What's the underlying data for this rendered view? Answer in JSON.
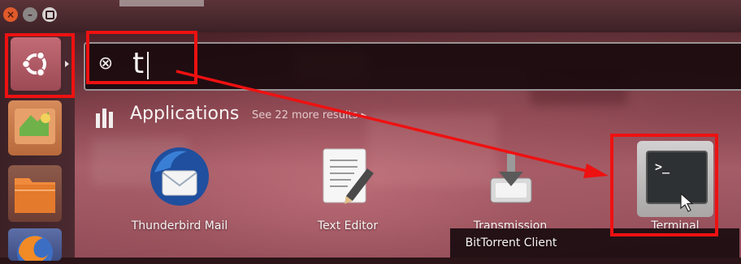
{
  "window": {
    "close_symbol": "×",
    "minimize_symbol": "–",
    "maximize_symbol": ""
  },
  "search": {
    "query": "t",
    "clear_icon": "⊗"
  },
  "category": {
    "label": "Applications",
    "see_more": "See 22 more results ▸"
  },
  "apps": [
    {
      "label": "Thunderbird Mail",
      "icon": "thunderbird-icon"
    },
    {
      "label": "Text Editor",
      "icon": "text-editor-icon"
    },
    {
      "label": "Transmission",
      "label_line2": "BitTorrent Client",
      "icon": "transmission-icon"
    },
    {
      "label": "Terminal",
      "icon": "terminal-icon",
      "prompt": ">_"
    }
  ],
  "colors": {
    "highlight_red": "#ee1111",
    "ubuntu_button": "#b45a66",
    "close_orange": "#e05a2b"
  }
}
